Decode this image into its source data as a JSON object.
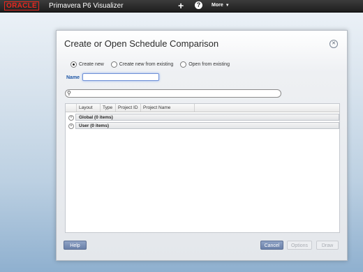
{
  "header": {
    "logo": "ORACLE",
    "app_title": "Primavera P6 Visualizer",
    "plus_icon": "+",
    "help_icon": "?",
    "more_label": "More",
    "more_caret": "▼"
  },
  "dialog": {
    "title": "Create or Open Schedule Comparison",
    "close_icon": "✕",
    "radios": [
      {
        "label": "Create new",
        "selected": true
      },
      {
        "label": "Create new from existing",
        "selected": false
      },
      {
        "label": "Open from existing",
        "selected": false
      }
    ],
    "name_label": "Name",
    "name_value": "",
    "search_value": "",
    "search_icon": "⚲",
    "columns": [
      "Layout",
      "Type",
      "Project ID",
      "Project Name"
    ],
    "groups": [
      {
        "label": "Global (0 items)",
        "expand_icon": "+"
      },
      {
        "label": "User (0 items)",
        "expand_icon": "+"
      }
    ],
    "buttons": {
      "help": "Help",
      "cancel": "Cancel",
      "options": "Options",
      "draw": "Draw"
    }
  },
  "colors": {
    "oracle_red": "#e8281e",
    "accent_blue": "#6a80a9",
    "name_label_blue": "#1e56a6"
  }
}
